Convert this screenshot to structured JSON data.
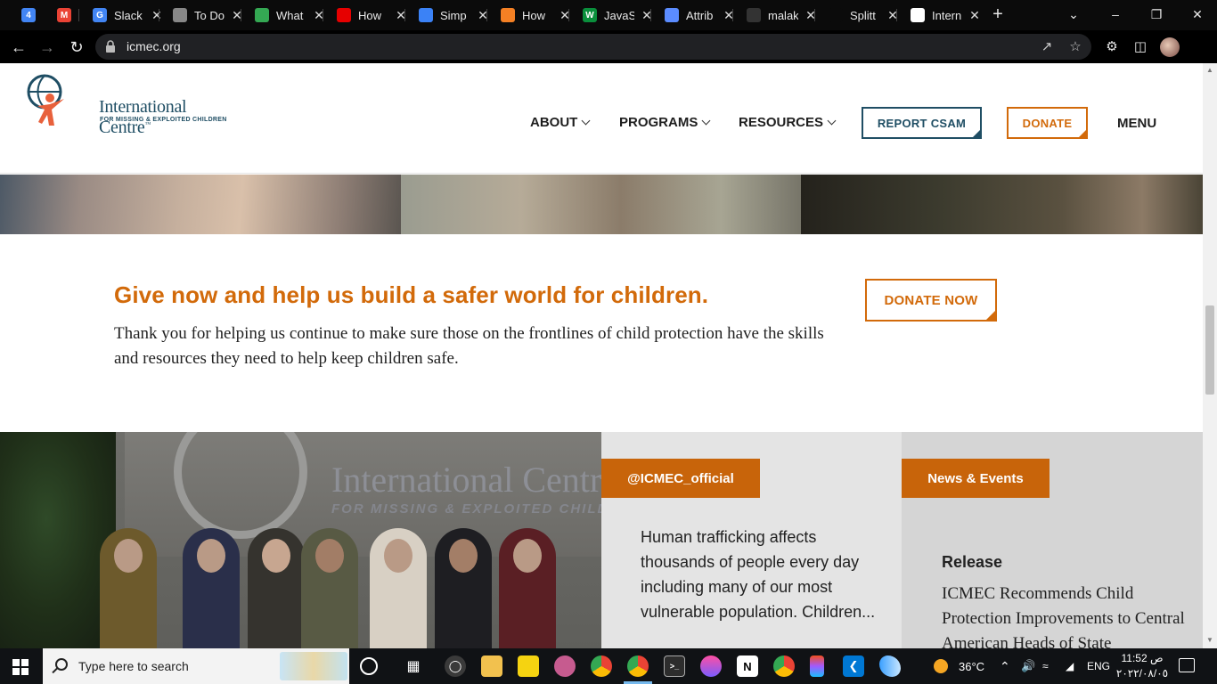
{
  "browser": {
    "tabs": [
      {
        "label": "",
        "icon": "calendar-icon",
        "color": "#4285f4",
        "glyph": "4"
      },
      {
        "label": "",
        "icon": "gmail-icon",
        "color": "#ea4335",
        "glyph": "M"
      },
      {
        "label": "Slack",
        "icon": "google-icon",
        "color": "#4285f4",
        "glyph": "G"
      },
      {
        "label": "To Do",
        "icon": "globe-icon",
        "color": "#888888",
        "glyph": ""
      },
      {
        "label": "What",
        "icon": "chrome-icon",
        "color": "#34a853",
        "glyph": ""
      },
      {
        "label": "How",
        "icon": "video-icon",
        "color": "#e60000",
        "glyph": ""
      },
      {
        "label": "Simp",
        "icon": "cloud-icon",
        "color": "#3b82f6",
        "glyph": ""
      },
      {
        "label": "How",
        "icon": "stack-icon",
        "color": "#f48024",
        "glyph": ""
      },
      {
        "label": "JavaS",
        "icon": "w-icon",
        "color": "#0a8f3c",
        "glyph": "W"
      },
      {
        "label": "Attrib",
        "icon": "moon-icon",
        "color": "#5b8cff",
        "glyph": ""
      },
      {
        "label": "malak",
        "icon": "github-icon",
        "color": "#333333",
        "glyph": ""
      },
      {
        "label": "Splitt",
        "icon": "blank-icon",
        "color": "#0b0b0b",
        "glyph": ""
      },
      {
        "label": "Intern",
        "icon": "icmec-icon",
        "color": "#ffffff",
        "glyph": ""
      }
    ],
    "url": "icmec.org",
    "min_label": "–",
    "max_label": "❐",
    "close_label": "✕"
  },
  "header": {
    "logo_name": "International Centre",
    "logo_tm": "™",
    "logo_sub": "FOR MISSING & EXPLOITED CHILDREN",
    "nav": [
      "ABOUT",
      "PROGRAMS",
      "RESOURCES"
    ],
    "report_label": "REPORT CSAM",
    "donate_label": "DONATE",
    "menu_label": "MENU"
  },
  "cta": {
    "title": "Give now and help us build a safer world for children.",
    "text": "Thank you for helping us continue to make sure those on the frontlines of child protection have the skills and resources they need to help keep children safe.",
    "button": "DONATE NOW"
  },
  "photo": {
    "sign_line1": "International Centre",
    "sign_line2": "FOR MISSING & EXPLOITED CHILDREN"
  },
  "twitter": {
    "tag": "@ICMEC_official",
    "text": "Human trafficking affects thousands of people every day including many of our most vulnerable population. Children..."
  },
  "news": {
    "tag": "News & Events",
    "kind": "Release",
    "title": "ICMEC Recommends Child Protection Improvements to Central American Heads of State"
  },
  "taskbar": {
    "search_placeholder": "Type here to search",
    "temperature": "36°C",
    "language": "ENG",
    "time": "11:52 ص",
    "date": "٢٠٢٢/٠٨/٠٥"
  },
  "colors": {
    "brand_blue": "#1f4e64",
    "brand_orange": "#d26a0a",
    "tag_orange": "#c8640a"
  }
}
